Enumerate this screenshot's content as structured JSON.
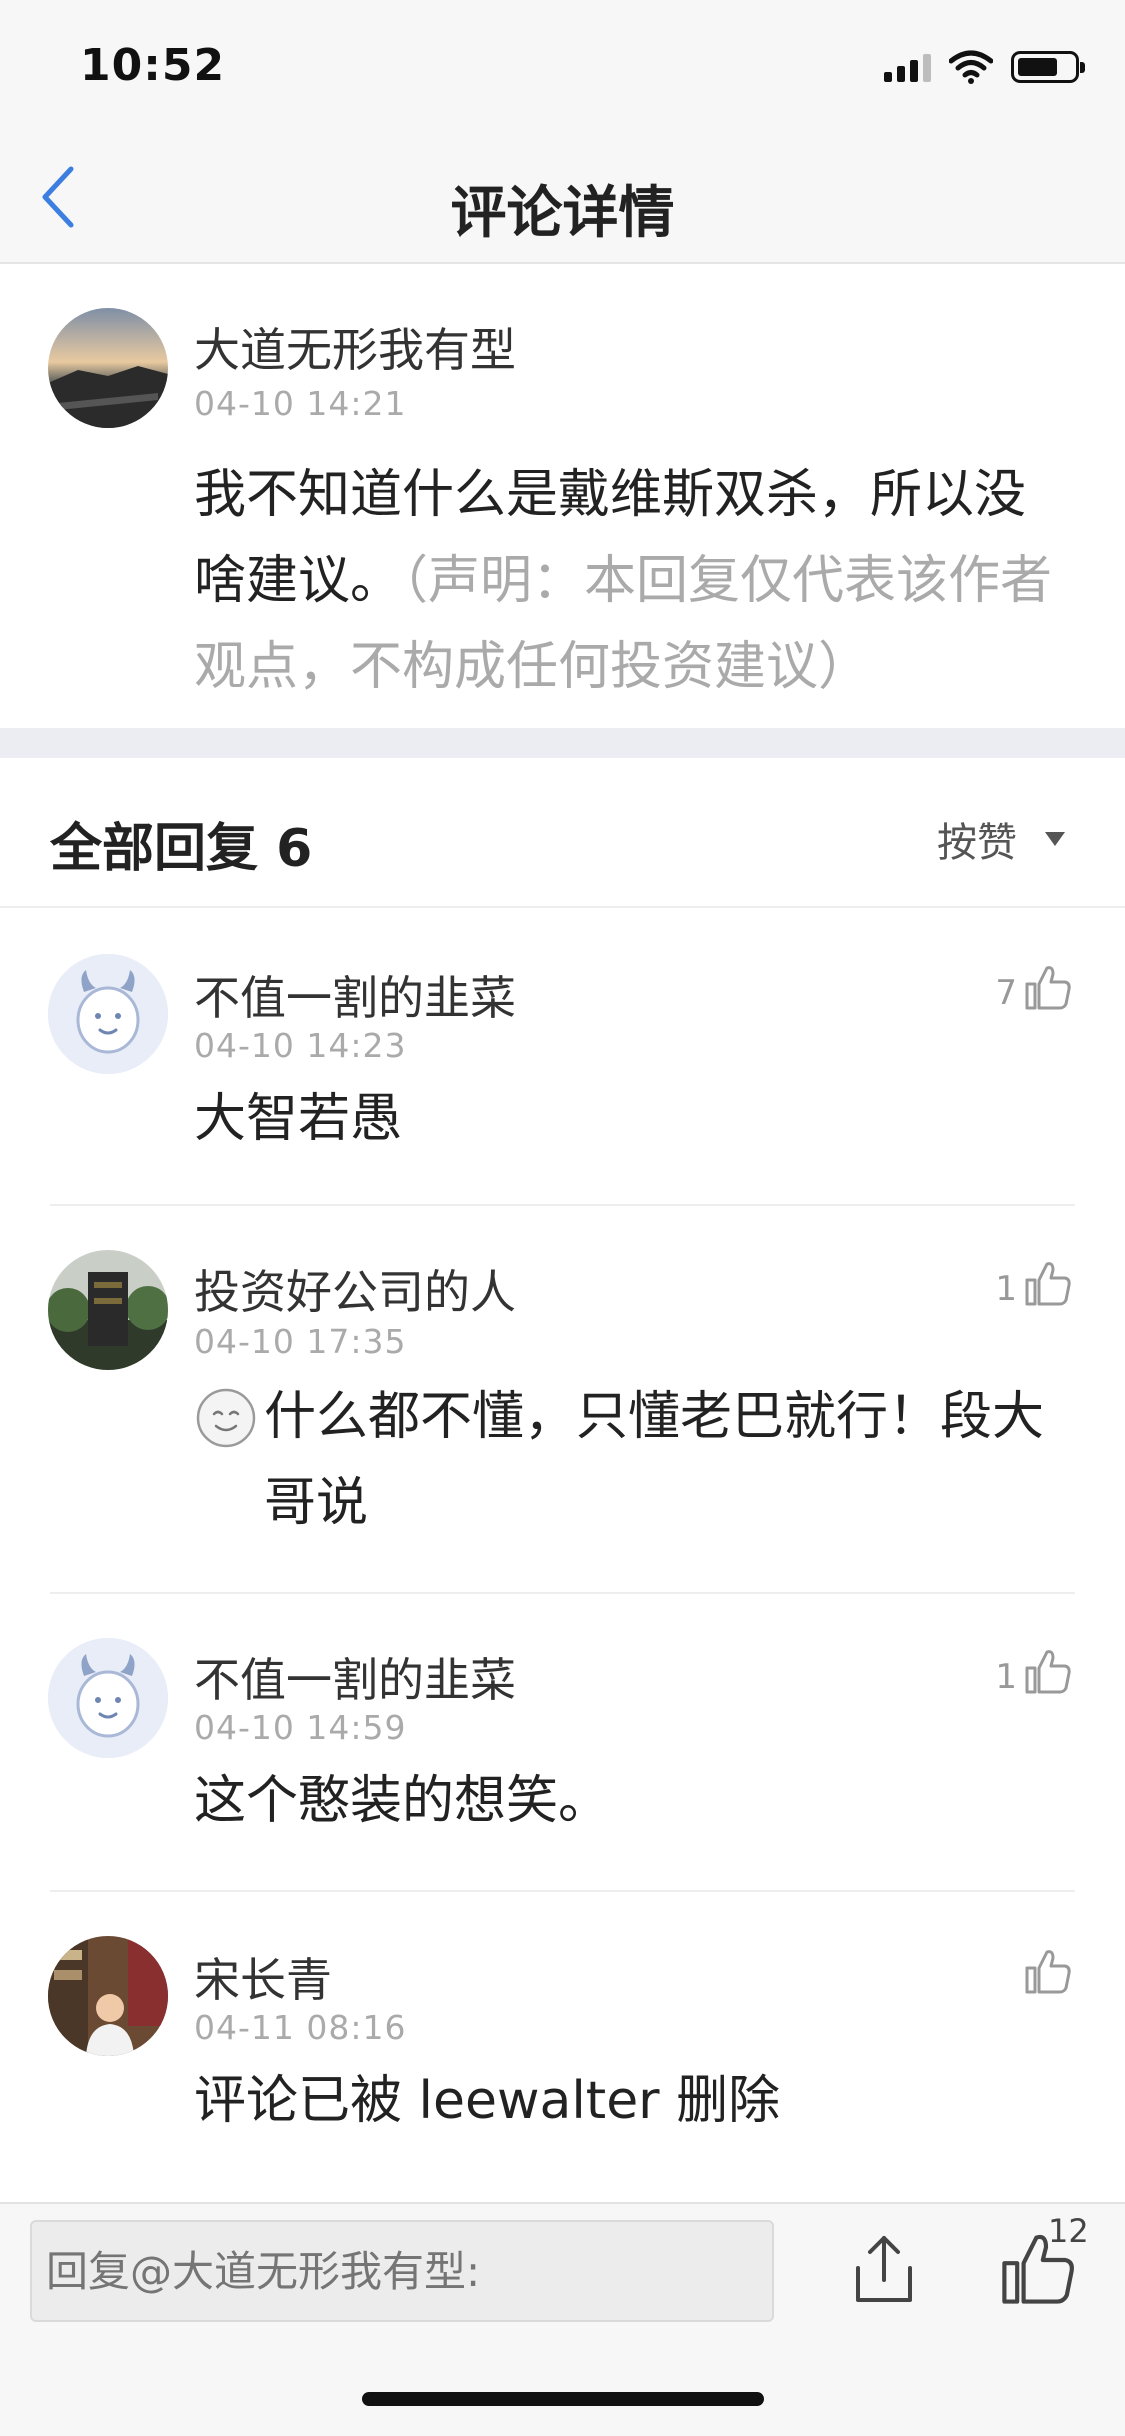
{
  "status_bar": {
    "time": "10:52"
  },
  "nav": {
    "title": "评论详情"
  },
  "main_comment": {
    "username": "大道无形我有型",
    "time": "04-10 14:21",
    "text": "我不知道什么是戴维斯双杀，所以没啥建议。",
    "disclaimer": "（声明：本回复仅代表该作者观点，不构成任何投资建议）"
  },
  "replies_header": {
    "title": "全部回复 6",
    "sort_label": "按赞"
  },
  "replies": [
    {
      "username": "不值一割的韭菜",
      "time": "04-10 14:23",
      "text": "大智若愚",
      "likes": "7"
    },
    {
      "username": "投资好公司的人",
      "time": "04-10 17:35",
      "text": "什么都不懂，只懂老巴就行！段大哥说",
      "likes": "1"
    },
    {
      "username": "不值一割的韭菜",
      "time": "04-10 14:59",
      "text": "这个憨装的想笑。",
      "likes": "1"
    },
    {
      "username": "宋长青",
      "time": "04-11 08:16",
      "text": "评论已被 leewalter 删除",
      "likes": ""
    }
  ],
  "bottom_bar": {
    "reply_placeholder": "回复@大道无形我有型:",
    "like_count": "12"
  },
  "icons": {
    "back": "chevron-left-icon",
    "like": "thumbs-up-icon",
    "share": "share-icon",
    "sort": "caret-down-icon",
    "emoji": "smile-emoji-icon"
  },
  "colors": {
    "accent": "#3d7fe0",
    "muted_text": "#aaaaaa",
    "section_gap": "#ebedf2"
  }
}
